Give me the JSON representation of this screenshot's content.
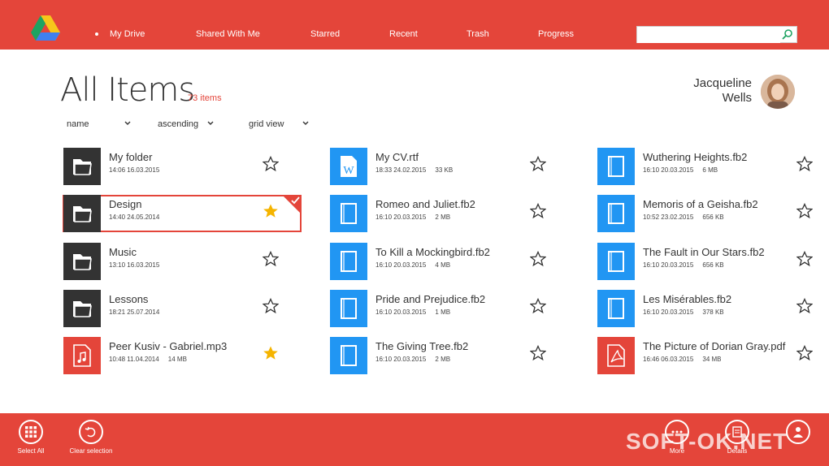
{
  "nav": {
    "items": [
      "My Drive",
      "Shared With Me",
      "Starred",
      "Recent",
      "Trash",
      "Progress"
    ],
    "search_placeholder": ""
  },
  "header": {
    "title": "All Items",
    "count": "73 items",
    "user_first": "Jacqueline",
    "user_last": "Wells"
  },
  "sort": {
    "field": "name",
    "order": "ascending",
    "view": "grid view"
  },
  "items": [
    {
      "name": "My folder",
      "meta": "14:06 16.03.2015",
      "type": "folder",
      "starred": false
    },
    {
      "name": "Design",
      "meta": "14:40 24.05.2014",
      "type": "folder",
      "starred": true,
      "selected": true
    },
    {
      "name": "Music",
      "meta": "13:10 16.03.2015",
      "type": "folder",
      "starred": false
    },
    {
      "name": "Lessons",
      "meta": "18:21 25.07.2014",
      "type": "folder",
      "starred": false
    },
    {
      "name": "Peer Kusiv - Gabriel.mp3",
      "meta": "10:48 11.04.2014     14 MB",
      "type": "music",
      "starred": true
    },
    {
      "name": "My CV.rtf",
      "meta": "18:33 24.02.2015     33 KB",
      "type": "word",
      "starred": false
    },
    {
      "name": "Romeo and Juliet.fb2",
      "meta": "16:10 20.03.2015     2 MB",
      "type": "book",
      "starred": false
    },
    {
      "name": "To Kill a Mockingbird.fb2",
      "meta": "16:10 20.03.2015     4 MB",
      "type": "book",
      "starred": false
    },
    {
      "name": "Pride and Prejudice.fb2",
      "meta": "16:10 20.03.2015     1 MB",
      "type": "book",
      "starred": false
    },
    {
      "name": "The Giving Tree.fb2",
      "meta": "16:10 20.03.2015     2 MB",
      "type": "book",
      "starred": false
    },
    {
      "name": "Wuthering Heights.fb2",
      "meta": "16:10 20.03.2015     6 MB",
      "type": "book",
      "starred": false
    },
    {
      "name": "Memoris of a Geisha.fb2",
      "meta": "10:52 23.02.2015     656 KB",
      "type": "book",
      "starred": false
    },
    {
      "name": "The Fault in Our Stars.fb2",
      "meta": "16:10 20.03.2015     656 KB",
      "type": "book",
      "starred": false
    },
    {
      "name": "Les Misérables.fb2",
      "meta": "16:10 20.03.2015     378 KB",
      "type": "book",
      "starred": false
    },
    {
      "name": "The Picture of Dorian Gray.pdf",
      "meta": "16:46 06.03.2015     34 MB",
      "type": "pdf",
      "starred": false
    }
  ],
  "bottom": {
    "select_all": "Select All",
    "clear_selection": "Clear selection",
    "more": "More",
    "details": "Details",
    "account": ""
  },
  "watermark": "SOFT-OK.NET",
  "colors": {
    "accent": "#e4453a",
    "folder": "#333333",
    "book": "#2196f3",
    "star_on": "#f5b400"
  }
}
